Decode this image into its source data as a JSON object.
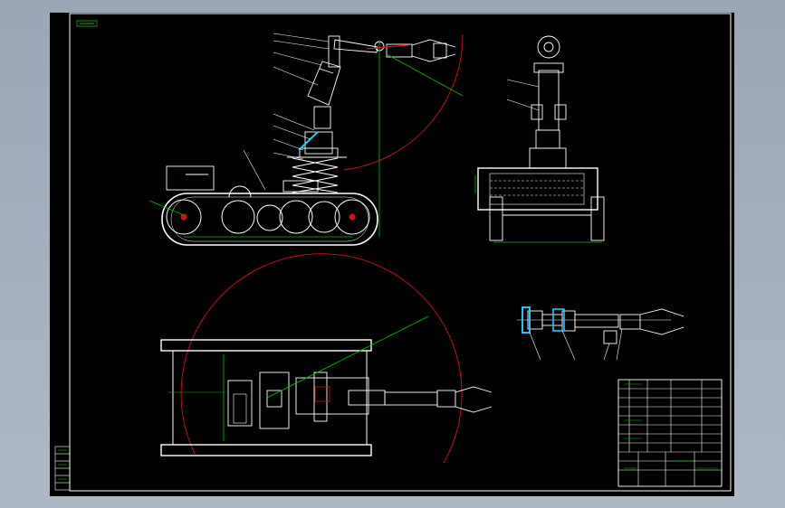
{
  "drawing": {
    "title_block": {
      "rows": [
        "",
        "",
        "",
        "",
        "",
        "",
        "",
        "",
        "",
        ""
      ],
      "header_cells": [
        "",
        "",
        "",
        "",
        ""
      ],
      "name_cell": "",
      "code_cell": ""
    },
    "colors": {
      "background": "#000000",
      "frame": "#ffffff",
      "outline": "#ffffff",
      "circle": "#d01414",
      "dimension": "#00d000",
      "leader": "#ffffff",
      "highlight": "#20c8ff",
      "badge": "#00a000"
    },
    "icons": [
      "tracked-chassis",
      "robot-arm",
      "gripper",
      "track-wheel",
      "scissor-lift"
    ]
  }
}
